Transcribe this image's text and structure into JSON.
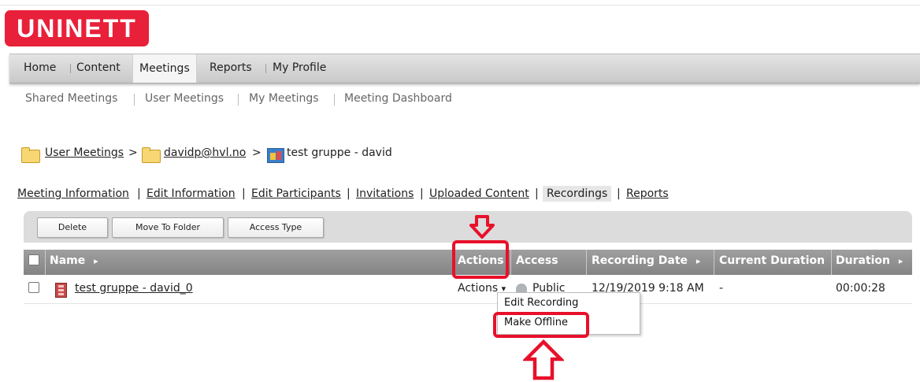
{
  "brand": {
    "logo_text": "UNINETT",
    "color": "#e8203a"
  },
  "main_tabs": [
    {
      "label": "Home"
    },
    {
      "label": "Content"
    },
    {
      "label": "Meetings",
      "active": true
    },
    {
      "label": "Reports"
    },
    {
      "label": "My Profile"
    }
  ],
  "sub_nav": [
    {
      "label": "Shared Meetings"
    },
    {
      "label": "User Meetings"
    },
    {
      "label": "My Meetings"
    },
    {
      "label": "Meeting Dashboard"
    }
  ],
  "breadcrumb": [
    {
      "label": "User Meetings",
      "icon": "folder-icon"
    },
    {
      "label": "davidp@hvl.no",
      "icon": "folder-icon"
    },
    {
      "label": "test gruppe - david",
      "icon": "meeting-icon"
    }
  ],
  "breadcrumb_separator": ">",
  "meeting_links": [
    {
      "label": "Meeting Information"
    },
    {
      "label": "Edit Information"
    },
    {
      "label": "Edit Participants"
    },
    {
      "label": "Invitations"
    },
    {
      "label": "Uploaded Content"
    },
    {
      "label": "Recordings",
      "active": true
    },
    {
      "label": "Reports"
    }
  ],
  "link_separator": "|",
  "toolbar": {
    "delete_label": "Delete",
    "move_label": "Move To Folder",
    "access_label": "Access Type"
  },
  "table": {
    "headers": {
      "name": "Name",
      "actions": "Actions",
      "access": "Access",
      "recording_date": "Recording Date",
      "current_duration": "Current Duration",
      "duration": "Duration"
    },
    "sort_glyph": "▸",
    "rows": [
      {
        "name": "test gruppe - david_0",
        "actions": "Actions",
        "actions_caret": "▾",
        "access": "Public",
        "recording_date": "12/19/2019 9:18 AM",
        "current_duration": "-",
        "duration": "00:00:28"
      }
    ]
  },
  "actions_menu": {
    "items": [
      {
        "label": "Edit Recording"
      },
      {
        "label": "Make Offline"
      }
    ]
  },
  "annotation_color": "#e8102a"
}
